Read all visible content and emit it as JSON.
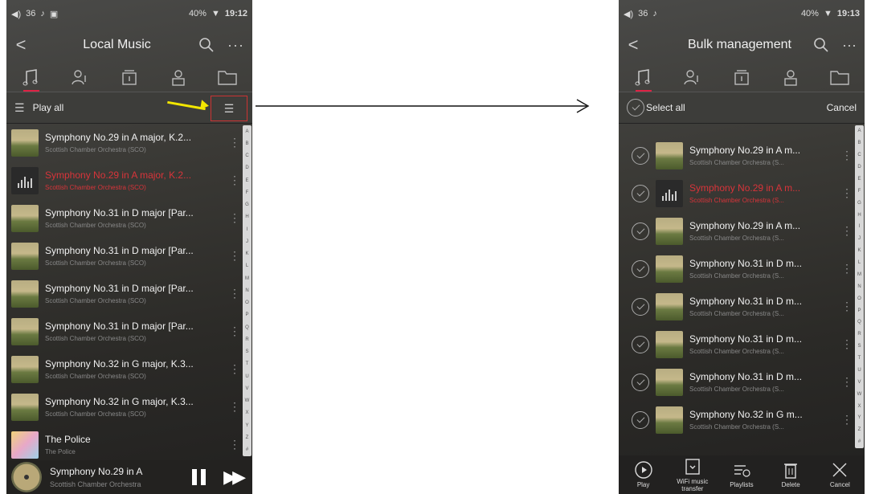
{
  "left": {
    "status": {
      "signal": "36",
      "time": "19:12",
      "battery": "40%"
    },
    "header": {
      "title": "Local Music"
    },
    "toolbar": {
      "play_all": "Play all"
    },
    "songs": [
      {
        "title": "Symphony No.29 in A major, K.2...",
        "artist": "Scottish Chamber Orchestra (SCO)"
      },
      {
        "title": "Symphony No.29 in A major, K.2...",
        "artist": "Scottish Chamber Orchestra (SCO)"
      },
      {
        "title": "Symphony No.31 in D major [Par...",
        "artist": "Scottish Chamber Orchestra (SCO)"
      },
      {
        "title": "Symphony No.31 in D major [Par...",
        "artist": "Scottish Chamber Orchestra (SCO)"
      },
      {
        "title": "Symphony No.31 in D major [Par...",
        "artist": "Scottish Chamber Orchestra (SCO)"
      },
      {
        "title": "Symphony No.31 in D major [Par...",
        "artist": "Scottish Chamber Orchestra (SCO)"
      },
      {
        "title": "Symphony No.32 in G major, K.3...",
        "artist": "Scottish Chamber Orchestra (SCO)"
      },
      {
        "title": "Symphony No.32 in G major, K.3...",
        "artist": "Scottish Chamber Orchestra (SCO)"
      },
      {
        "title": "The Police",
        "artist": "The Police"
      }
    ],
    "now_playing": {
      "title": "Symphony No.29 in A",
      "artist": "Scottish Chamber Orchestra"
    }
  },
  "right": {
    "status": {
      "signal": "36",
      "time": "19:13",
      "battery": "40%"
    },
    "header": {
      "title": "Bulk management"
    },
    "toolbar": {
      "select_all": "Select all",
      "cancel": "Cancel"
    },
    "songs": [
      {
        "title": "Symphony No.29 in A m...",
        "artist": "Scottish Chamber Orchestra (S..."
      },
      {
        "title": "Symphony No.29 in A m...",
        "artist": "Scottish Chamber Orchestra (S..."
      },
      {
        "title": "Symphony No.29 in A m...",
        "artist": "Scottish Chamber Orchestra (S..."
      },
      {
        "title": "Symphony No.31 in D m...",
        "artist": "Scottish Chamber Orchestra (S..."
      },
      {
        "title": "Symphony No.31 in D m...",
        "artist": "Scottish Chamber Orchestra (S..."
      },
      {
        "title": "Symphony No.31 in D m...",
        "artist": "Scottish Chamber Orchestra (S..."
      },
      {
        "title": "Symphony No.31 in D m...",
        "artist": "Scottish Chamber Orchestra (S..."
      },
      {
        "title": "Symphony No.32 in G m...",
        "artist": "Scottish Chamber Orchestra (S..."
      }
    ],
    "bottom": {
      "play": "Play",
      "wifi": "WiFi music transfer",
      "playlists": "Playlists",
      "delete": "Delete",
      "cancel": "Cancel"
    }
  },
  "alphabet": [
    "A",
    "B",
    "C",
    "D",
    "E",
    "F",
    "G",
    "H",
    "I",
    "J",
    "K",
    "L",
    "M",
    "N",
    "O",
    "P",
    "Q",
    "R",
    "S",
    "T",
    "U",
    "V",
    "W",
    "X",
    "Y",
    "Z",
    "#"
  ],
  "colors": {
    "accent": "#d8343a",
    "highlight_arrow": "#f2e600"
  }
}
